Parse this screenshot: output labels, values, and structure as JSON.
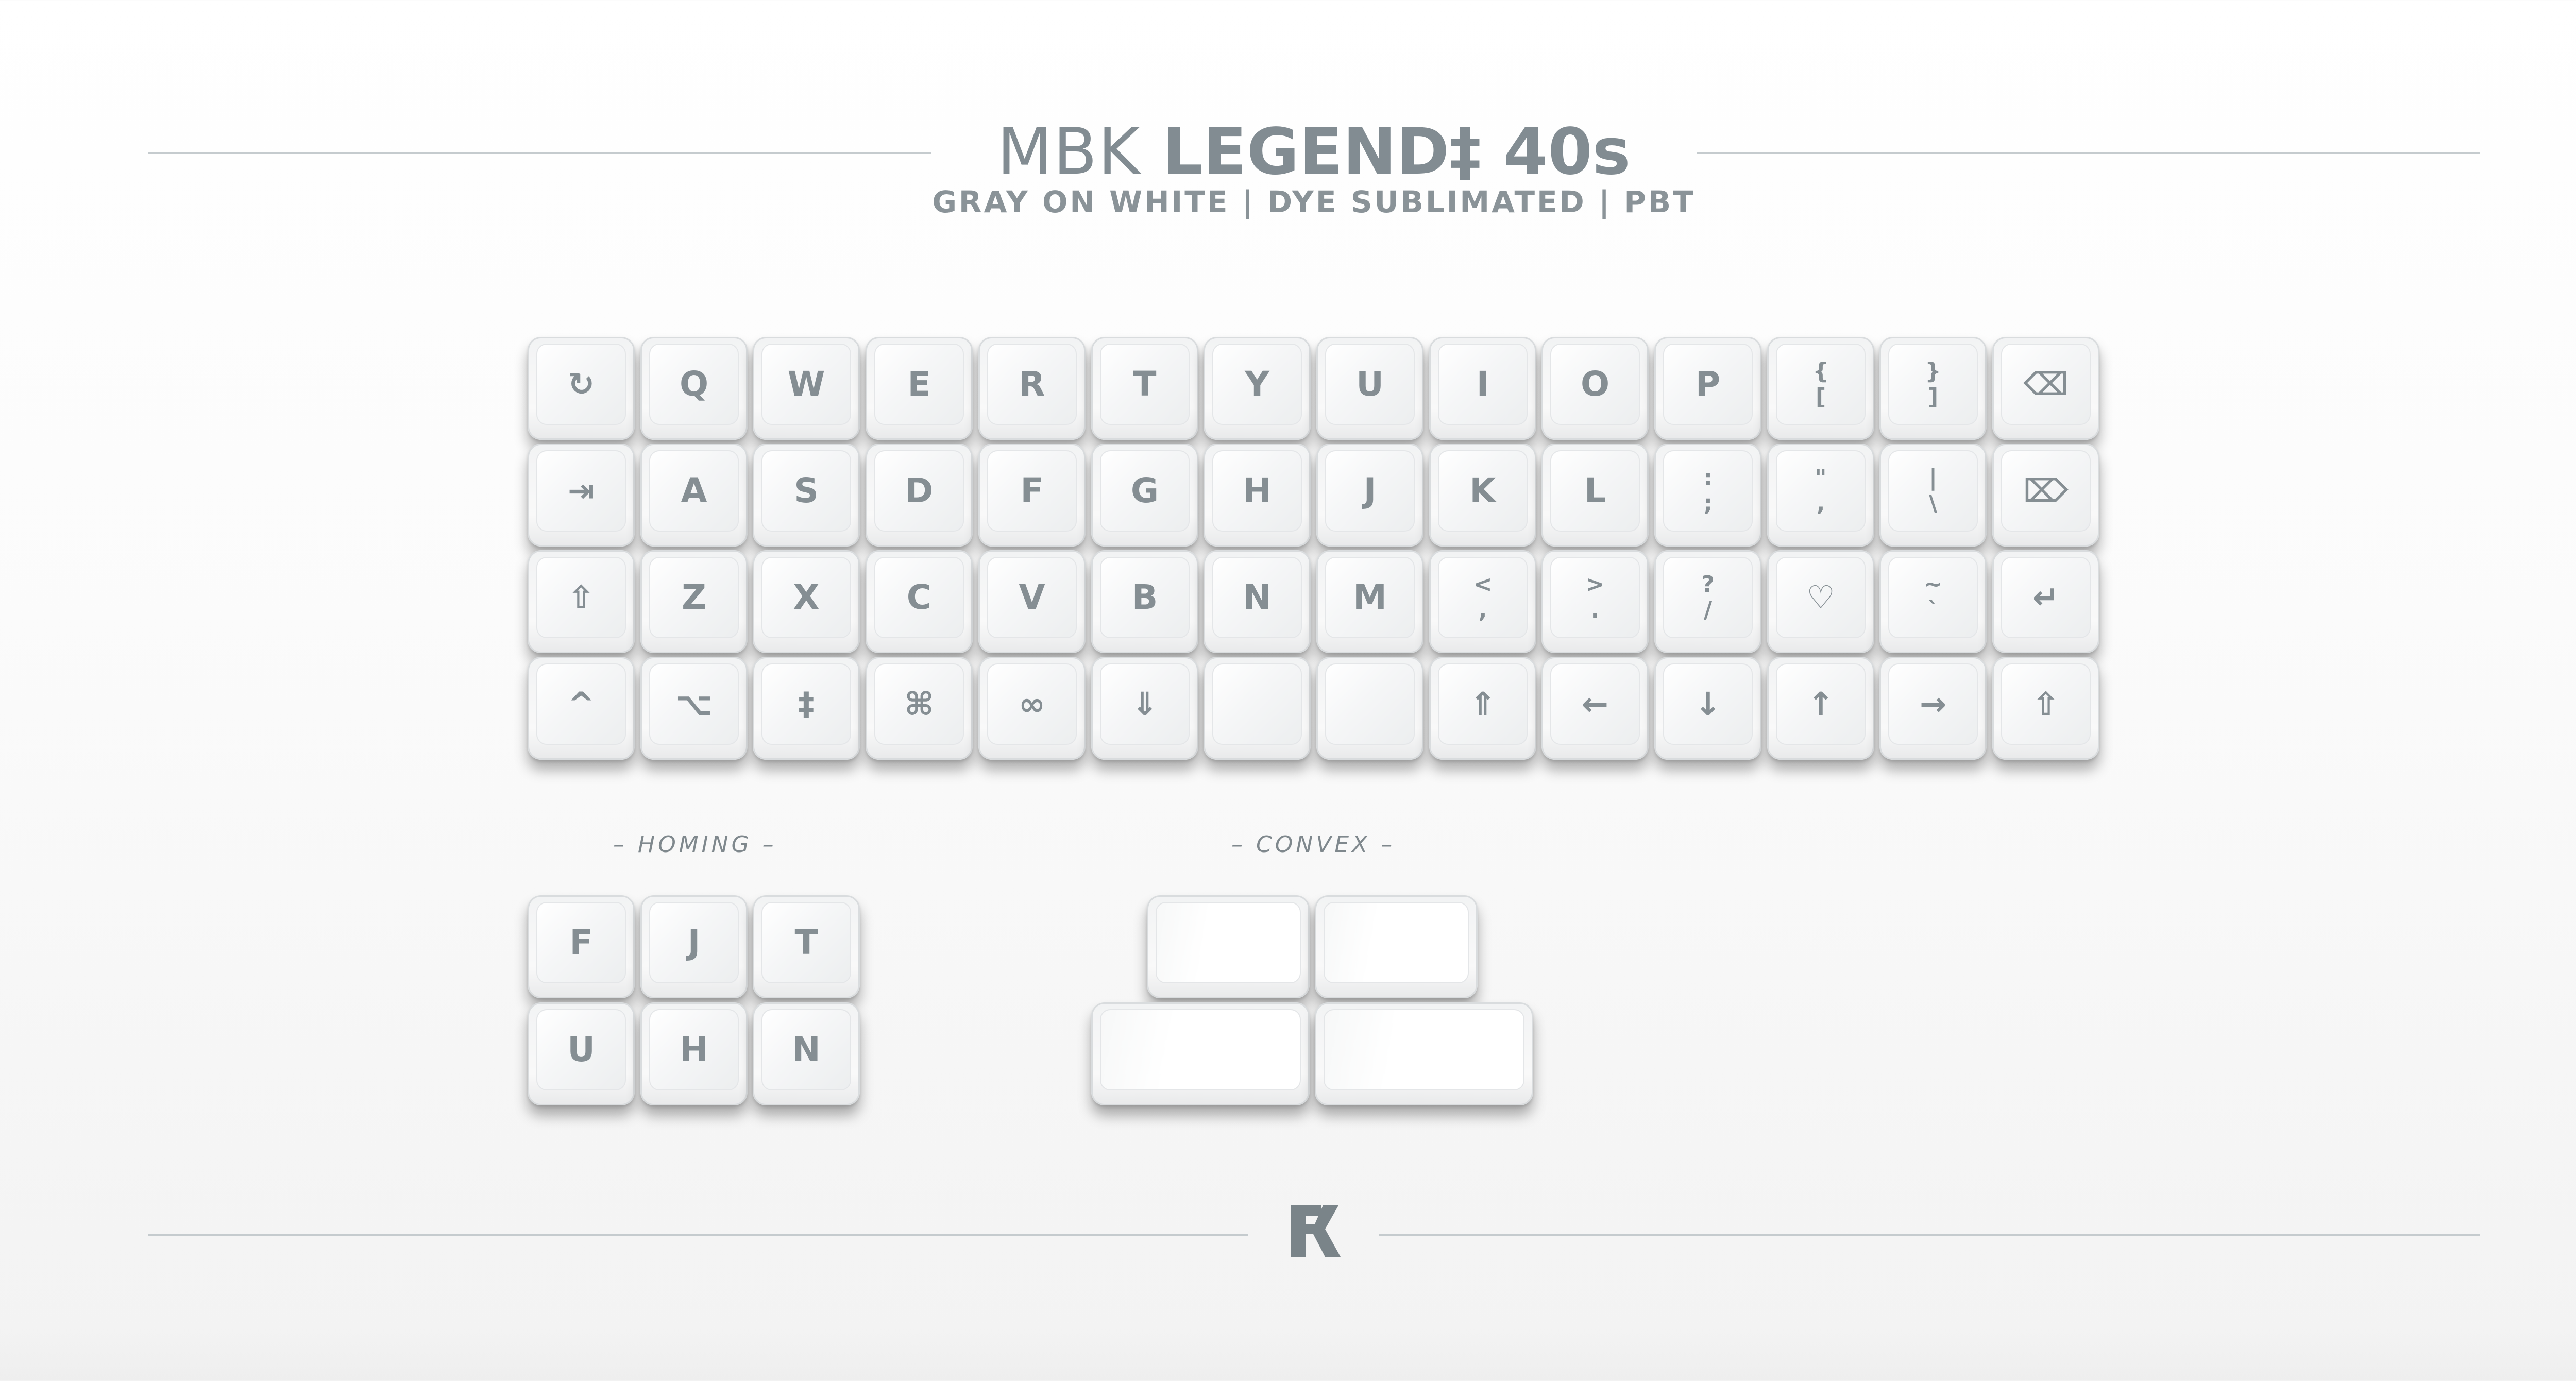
{
  "header": {
    "title_light": "MBK ",
    "title_bold": "LEGEND‡ 40s",
    "subtitle": "GRAY ON WHITE | DYE SUBLIMATED | PBT"
  },
  "keyboard": {
    "rows": [
      [
        {
          "icon": "refresh-icon",
          "legend": "↻"
        },
        {
          "legend": "Q"
        },
        {
          "legend": "W"
        },
        {
          "legend": "E"
        },
        {
          "legend": "R"
        },
        {
          "legend": "T"
        },
        {
          "legend": "Y"
        },
        {
          "legend": "U"
        },
        {
          "legend": "I"
        },
        {
          "legend": "O"
        },
        {
          "legend": "P"
        },
        {
          "top": "{",
          "bottom": "["
        },
        {
          "top": "}",
          "bottom": "]"
        },
        {
          "icon": "backspace-icon",
          "legend": "⌫"
        }
      ],
      [
        {
          "icon": "tab-icon",
          "legend": "⇥"
        },
        {
          "legend": "A"
        },
        {
          "legend": "S"
        },
        {
          "legend": "D"
        },
        {
          "legend": "F"
        },
        {
          "legend": "G"
        },
        {
          "legend": "H"
        },
        {
          "legend": "J"
        },
        {
          "legend": "K"
        },
        {
          "legend": "L"
        },
        {
          "top": ":",
          "bottom": ";"
        },
        {
          "top": "\"",
          "bottom": ","
        },
        {
          "top": "|",
          "bottom": "\\"
        },
        {
          "icon": "delete-forward-icon",
          "legend": "⌦"
        }
      ],
      [
        {
          "icon": "shift-icon",
          "legend": "⇧"
        },
        {
          "legend": "Z"
        },
        {
          "legend": "X"
        },
        {
          "legend": "C"
        },
        {
          "legend": "V"
        },
        {
          "legend": "B"
        },
        {
          "legend": "N"
        },
        {
          "legend": "M"
        },
        {
          "top": "<",
          "bottom": ","
        },
        {
          "top": ">",
          "bottom": "."
        },
        {
          "top": "?",
          "bottom": "/"
        },
        {
          "icon": "heart-icon",
          "legend": "♡"
        },
        {
          "top": "~",
          "bottom": "`"
        },
        {
          "icon": "return-icon",
          "legend": "↵"
        }
      ],
      [
        {
          "icon": "control-icon",
          "legend": "^"
        },
        {
          "icon": "option-icon",
          "legend": "⌥"
        },
        {
          "icon": "double-dagger-icon",
          "legend": "‡"
        },
        {
          "icon": "command-icon",
          "legend": "⌘"
        },
        {
          "icon": "infinity-icon",
          "legend": "∞"
        },
        {
          "icon": "lower-icon",
          "legend": "⇓"
        },
        {
          "legend": ""
        },
        {
          "legend": ""
        },
        {
          "icon": "raise-icon",
          "legend": "⇑"
        },
        {
          "icon": "arrow-left-icon",
          "legend": "←"
        },
        {
          "icon": "arrow-down-icon",
          "legend": "↓"
        },
        {
          "icon": "arrow-up-icon",
          "legend": "↑"
        },
        {
          "icon": "arrow-right-icon",
          "legend": "→"
        },
        {
          "icon": "shift-icon",
          "legend": "⇧"
        }
      ]
    ]
  },
  "homing": {
    "label": "– HOMING –",
    "rows": [
      [
        "F",
        "J",
        "T"
      ],
      [
        "U",
        "H",
        "N"
      ]
    ]
  },
  "convex": {
    "label": "– CONVEX –"
  },
  "colors": {
    "legend": "#858e93",
    "rule": "#c5cbce",
    "key_face": "#ffffff"
  },
  "footer": {
    "logo": "fk-logo-icon"
  }
}
